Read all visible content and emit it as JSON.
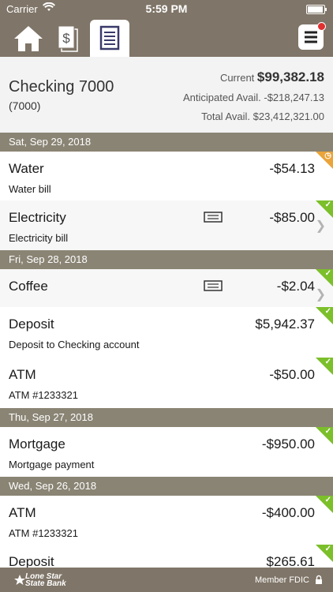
{
  "status_bar": {
    "carrier": "Carrier",
    "time": "5:59 PM"
  },
  "nav": {
    "tabs": [
      "home-icon",
      "money-stack-icon",
      "ledger-icon"
    ],
    "active_tab": "ledger-icon",
    "menu": "hamburger-menu-icon"
  },
  "account": {
    "name": "Checking 7000",
    "number": "(7000)",
    "current_label": "Current ",
    "current_value": "$99,382.18",
    "anticipated": "Anticipated Avail. -$218,247.13",
    "total": "Total Avail. $23,412,321.00"
  },
  "dates": [
    "Sat, Sep 29, 2018",
    "Fri, Sep 28, 2018",
    "Thu, Sep 27, 2018",
    "Wed, Sep 26, 2018"
  ],
  "transactions": [
    {
      "name": "Water",
      "desc": "Water bill",
      "amount": "-$54.13",
      "status": "pending"
    },
    {
      "name": "Electricity",
      "desc": "Electricity bill",
      "amount": "-$85.00",
      "status": "cleared"
    },
    {
      "name": "Coffee",
      "desc": "",
      "amount": "-$2.04",
      "status": "cleared"
    },
    {
      "name": "Deposit",
      "desc": "Deposit to Checking account",
      "amount": "$5,942.37",
      "status": "cleared"
    },
    {
      "name": "ATM",
      "desc": "ATM #1233321",
      "amount": "-$50.00",
      "status": "cleared"
    },
    {
      "name": "Mortgage",
      "desc": "Mortgage payment",
      "amount": "-$950.00",
      "status": "cleared"
    },
    {
      "name": "ATM",
      "desc": "ATM #1233321",
      "amount": "-$400.00",
      "status": "cleared"
    },
    {
      "name": "Deposit",
      "desc": "",
      "amount": "$265.61",
      "status": "cleared"
    }
  ],
  "footer": {
    "bank_line1": "Lone Star",
    "bank_line2": "State Bank",
    "fdic": "Member FDIC"
  },
  "colors": {
    "brand": "#7f7568",
    "date_header": "#8a8474",
    "cleared": "#7bbf2a",
    "pending": "#eaa43a"
  }
}
